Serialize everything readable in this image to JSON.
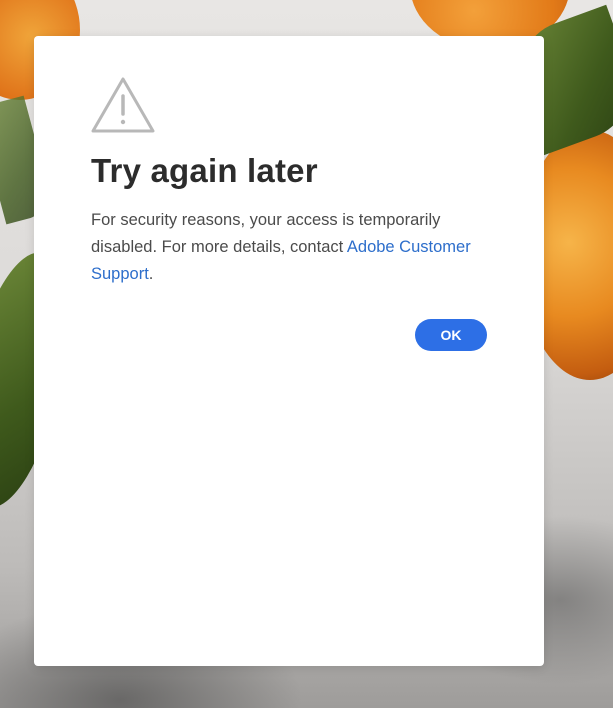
{
  "dialog": {
    "title": "Try again later",
    "message_before_link": "For security reasons, your access is temporarily disabled. For more details, contact ",
    "link_text": "Adobe Customer Support",
    "message_after_link": ".",
    "ok_label": "OK",
    "icon": "alert-triangle-icon"
  },
  "colors": {
    "link": "#2d6ecb",
    "button": "#2d6fe6",
    "title": "#2c2c2c",
    "body_text": "#4b4b4b"
  }
}
